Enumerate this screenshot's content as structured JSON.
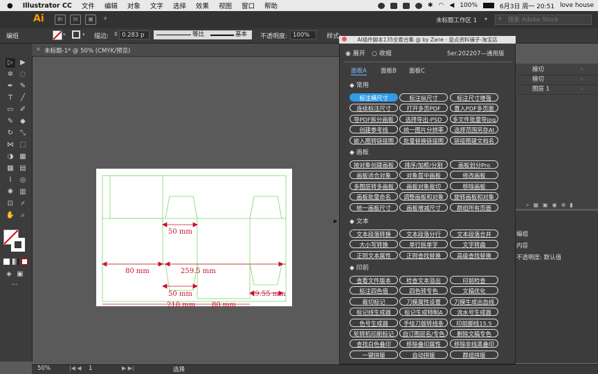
{
  "menubar": {
    "app_name": "Illustrator CC",
    "items": [
      "文件",
      "编辑",
      "对象",
      "文字",
      "选择",
      "效果",
      "视图",
      "窗口",
      "帮助"
    ],
    "battery": "100%",
    "datetime": "6月3日 周一  20:51",
    "user": "love house"
  },
  "appbar": {
    "logo": "Ai",
    "btn_br": "Br",
    "btn_st": "St",
    "workspace": "未标题工作区 1",
    "search_placeholder": "搜索 Adobe Stock"
  },
  "controlbar": {
    "selection_label": "编组",
    "stroke_label": "描边:",
    "stroke_value": "0.283 p",
    "profile_label": "等比",
    "brush_label": "基本",
    "opacity_label": "不透明度:",
    "opacity_value": "100%",
    "style_label": "样式:"
  },
  "document": {
    "tab_title": "未标题-1* @ 50% (CMYK/预览)",
    "zoom": "50%",
    "page": "1",
    "status": "选择"
  },
  "artwork": {
    "labels": [
      "50 mm",
      "80 mm",
      "259.5 mm",
      "50 mm",
      "49.55 mm",
      "210 mm",
      "80 mm"
    ]
  },
  "layers_panel": {
    "rows": [
      "模切",
      "模切",
      "图层 1"
    ]
  },
  "properties_panel": {
    "lines": [
      "编组",
      "内容",
      "不透明度: 默认值"
    ]
  },
  "plugin": {
    "title": "AI插件脚本135全套合集 @ by Zane - 壹点资料铺子-淘宝店",
    "radio_expand": "展开",
    "radio_collapse": "收缩",
    "version": "Ser.202207—通用版",
    "tabs": [
      "面板A",
      "面板B",
      "面板C"
    ],
    "sections": [
      {
        "title": "◆ 常用",
        "buttons": [
          "标注横尺寸",
          "标注纵尺寸",
          "标注尺寸增强",
          "连续标注尺寸",
          "打开多页PDF",
          "置入PDF多页面",
          "导PDF拆分画板",
          "选择导出-PSD",
          "多文件批量导jpg",
          "创建参考线",
          "统一图片分辨率",
          "选择范围另存AI",
          "嵌入图转链接图",
          "批量替换链接图",
          "链接图建文档名"
        ]
      },
      {
        "title": "◆ 画板",
        "buttons": [
          "按对象创建画板",
          "排序/加框/分割",
          "画板划分Pro",
          "画板适合对象",
          "对象居中画板",
          "修改画板",
          "多图层转多画板",
          "画板对象裁切",
          "移除画板",
          "画板批量命名",
          "调整画板和对象",
          "旋转画板和对象",
          "统一画板尺寸",
          "画板增减尺寸",
          "群组所有页面"
        ]
      },
      {
        "title": "◆ 文本",
        "buttons": [
          "文本段落转换",
          "文本段落分行",
          "文本段落合并",
          "大小写转换",
          "单行拆单字",
          "文字转曲",
          "正则文本属性",
          "正则查找替换",
          "高级查找替换"
        ]
      },
      {
        "title": "◆ 印前",
        "buttons": [
          "查看文件版本",
          "检查文本溢出",
          "印前检查",
          "标注四色值",
          "四色转专色",
          "文稿优化",
          "裁切标记",
          "刀模属性设置",
          "刀模生成出血线",
          "标记线生成器",
          "标记生成特制A",
          "流水号生成器",
          "色号生成器",
          "手绘刀版转线条",
          "印前脚线15.5",
          "轮转机印刷标记",
          "自订图层名/专色",
          "删除文稿专色",
          "查找白色叠印",
          "移除叠印属性",
          "移除非线黑叠印",
          "一键拼版",
          "自动拼版",
          "群组拼版"
        ]
      }
    ]
  }
}
